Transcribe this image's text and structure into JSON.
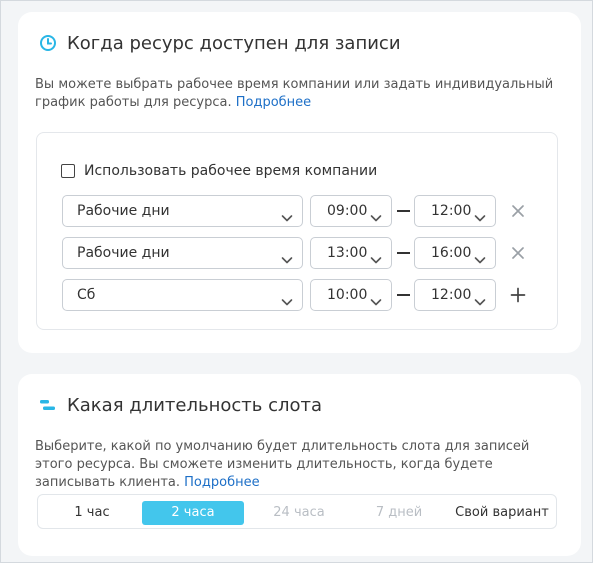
{
  "availability": {
    "title": "Когда ресурс доступен для записи",
    "title_icon": "clock-icon",
    "description": "Вы можете выбрать рабочее время компании или задать индивидуальный график работы для ресурса.",
    "link": "Подробнее",
    "use_company_hours_label": "Использовать рабочее время компании",
    "use_company_hours_checked": false,
    "rows": [
      {
        "days": "Рабочие дни",
        "from": "09:00",
        "to": "12:00",
        "action": "remove-icon"
      },
      {
        "days": "Рабочие дни",
        "from": "13:00",
        "to": "16:00",
        "action": "remove-icon"
      },
      {
        "days": "Сб",
        "from": "10:00",
        "to": "12:00",
        "action": "add-icon"
      }
    ]
  },
  "slot": {
    "title": "Какая длительность слота",
    "title_icon": "duration-icon",
    "description": "Выберите, какой по умолчанию будет длительность слота для записей этого ресурса. Вы сможете изменить длительность, когда будете записывать клиента.",
    "link": "Подробнее",
    "options": [
      {
        "label": "1 час",
        "state": "normal"
      },
      {
        "label": "2 часа",
        "state": "active"
      },
      {
        "label": "24 часа",
        "state": "disabled"
      },
      {
        "label": "7 дней",
        "state": "disabled"
      },
      {
        "label": "Свой вариант",
        "state": "normal"
      }
    ]
  },
  "colors": {
    "accent": "#43c6ec",
    "link": "#1d6fc7",
    "background": "#f3f5f7",
    "card": "#ffffff"
  }
}
